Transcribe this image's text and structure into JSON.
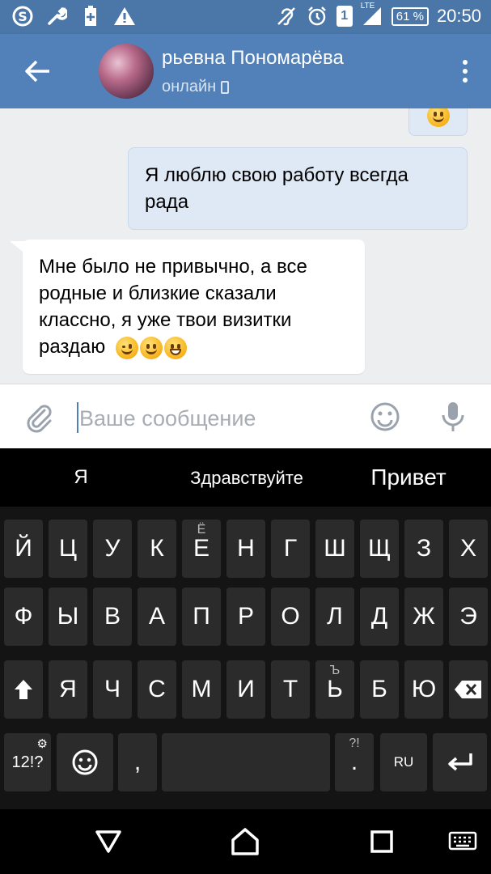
{
  "status_bar": {
    "time": "20:50",
    "battery": "61 %",
    "sim": "1",
    "network": "LTE",
    "icons": [
      "skype-icon",
      "wrench-icon",
      "battery-plus-icon",
      "warning-icon",
      "hearing-aid-icon",
      "alarm-icon",
      "signal-icon"
    ]
  },
  "header": {
    "contact_name": "рьевна Пономарёва",
    "status": "онлайн",
    "accent": "#5181b8"
  },
  "messages": [
    {
      "direction": "out",
      "text": "",
      "emojis": [
        "smile"
      ]
    },
    {
      "direction": "out",
      "text": "Я люблю свою работу всегда рада"
    },
    {
      "direction": "in",
      "text": "Мне было не привычно, а все родные и близкие сказали классно, я уже твои визитки раздаю",
      "emojis": [
        "wink",
        "smile",
        "grin"
      ]
    }
  ],
  "compose": {
    "placeholder": "Ваше сообщение",
    "value": ""
  },
  "keyboard": {
    "suggestions": [
      "Я",
      "Здравствуйте",
      "Привет"
    ],
    "row1": [
      {
        "label": "Й"
      },
      {
        "label": "Ц"
      },
      {
        "label": "У"
      },
      {
        "label": "К"
      },
      {
        "label": "Е",
        "hint": "Ё"
      },
      {
        "label": "Н"
      },
      {
        "label": "Г"
      },
      {
        "label": "Ш"
      },
      {
        "label": "Щ"
      },
      {
        "label": "З"
      },
      {
        "label": "Х"
      }
    ],
    "row2": [
      {
        "label": "Ф"
      },
      {
        "label": "Ы"
      },
      {
        "label": "В"
      },
      {
        "label": "А"
      },
      {
        "label": "П"
      },
      {
        "label": "Р"
      },
      {
        "label": "О"
      },
      {
        "label": "Л"
      },
      {
        "label": "Д"
      },
      {
        "label": "Ж"
      },
      {
        "label": "Э"
      }
    ],
    "row3": [
      {
        "label": "Я"
      },
      {
        "label": "Ч"
      },
      {
        "label": "С"
      },
      {
        "label": "М"
      },
      {
        "label": "И"
      },
      {
        "label": "Т"
      },
      {
        "label": "Ь",
        "hint": "Ъ"
      },
      {
        "label": "Б"
      },
      {
        "label": "Ю"
      }
    ],
    "symbols_label": "12!?",
    "comma": ",",
    "period": ".",
    "period_hint": "?!",
    "lang": "RU"
  }
}
